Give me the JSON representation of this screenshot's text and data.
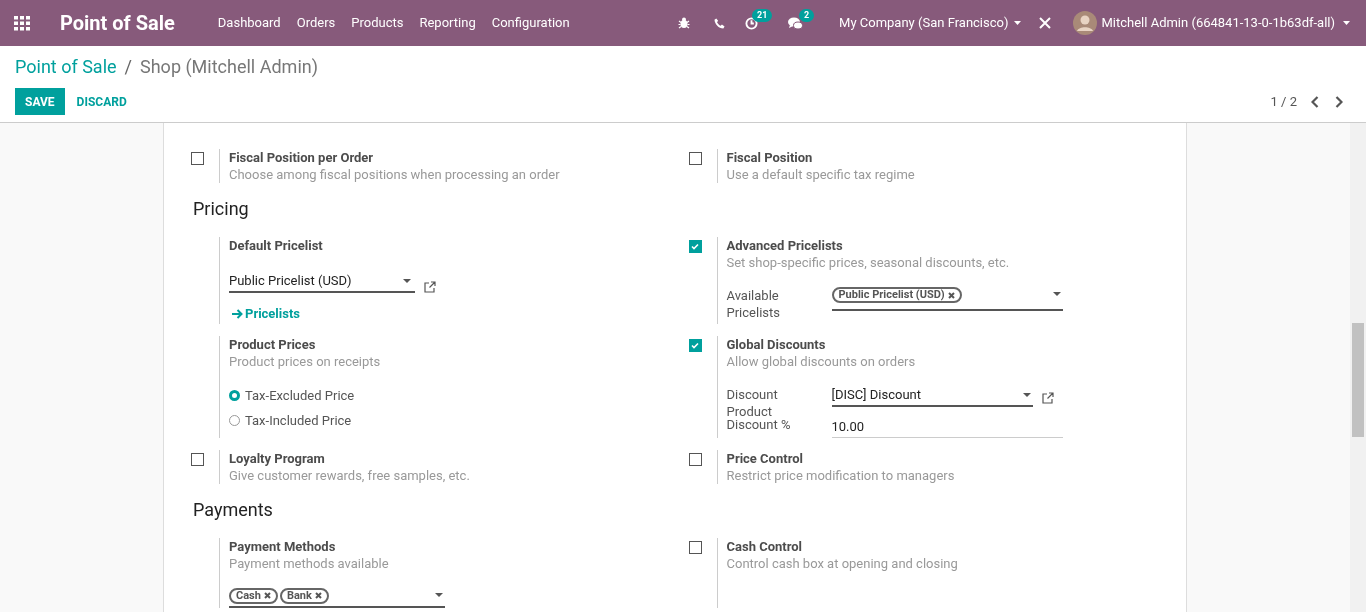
{
  "navbar": {
    "app_title": "Point of Sale",
    "menu": [
      "Dashboard",
      "Orders",
      "Products",
      "Reporting",
      "Configuration"
    ],
    "activity_count": "21",
    "message_count": "2",
    "company": "My Company (San Francisco)",
    "user": "Mitchell Admin (664841-13-0-1b63df-all)"
  },
  "breadcrumb_separator": "/",
  "breadcrumb": [
    {
      "label": "Point of Sale",
      "kind": "link"
    },
    {
      "label": "Shop (Mitchell Admin)",
      "kind": "current"
    }
  ],
  "buttons": [
    {
      "label": "SAVE",
      "kind": "primary"
    },
    {
      "label": "DISCARD",
      "kind": "secondary"
    }
  ],
  "pager": "1 / 2",
  "sections": [
    {
      "rows": [
        [
          {
            "kind": "checkbox",
            "checked": false,
            "title": "Fiscal Position per Order",
            "description": "Choose among fiscal positions when processing an order"
          },
          {
            "kind": "checkbox",
            "checked": false,
            "title": "Fiscal Position",
            "description": "Use a default specific tax regime"
          }
        ]
      ]
    },
    {
      "title": "Pricing",
      "rows": [
        [
          {
            "kind": "plain",
            "title": "Default Pricelist",
            "extras": [
              {
                "kind": "select",
                "value": "Public Pricelist (USD)"
              },
              {
                "kind": "link",
                "label": "Pricelists"
              }
            ]
          },
          {
            "kind": "checkbox",
            "checked": true,
            "title": "Advanced Pricelists",
            "description": "Set shop-specific prices, seasonal discounts, etc.",
            "extras": [
              {
                "kind": "labeled_tags",
                "label": "Available Pricelists",
                "tags": [
                  "Public Pricelist (USD)"
                ]
              }
            ]
          }
        ],
        [
          {
            "kind": "plain",
            "title": "Product Prices",
            "description": "Product prices on receipts",
            "extras": [
              {
                "kind": "radio",
                "options": [
                  {
                    "label": "Tax-Excluded Price",
                    "selected": true
                  },
                  {
                    "label": "Tax-Included Price",
                    "selected": false
                  }
                ]
              }
            ]
          },
          {
            "kind": "checkbox",
            "checked": true,
            "title": "Global Discounts",
            "description": "Allow global discounts on orders",
            "extras": [
              {
                "kind": "labeled_select",
                "label": "Discount Product",
                "value": "[DISC] Discount"
              },
              {
                "kind": "labeled_input",
                "label": "Discount %",
                "value": "10.00"
              }
            ]
          }
        ],
        [
          {
            "kind": "checkbox",
            "checked": false,
            "title": "Loyalty Program",
            "description": "Give customer rewards, free samples, etc."
          },
          {
            "kind": "checkbox",
            "checked": false,
            "title": "Price Control",
            "description": "Restrict price modification to managers"
          }
        ]
      ]
    },
    {
      "title": "Payments",
      "rows": [
        [
          {
            "kind": "plain",
            "title": "Payment Methods",
            "description": "Payment methods available",
            "extras": [
              {
                "kind": "tags",
                "tags": [
                  "Cash",
                  "Bank"
                ]
              }
            ]
          },
          {
            "kind": "checkbox",
            "checked": false,
            "title": "Cash Control",
            "description": "Control cash box at opening and closing"
          }
        ]
      ]
    }
  ]
}
